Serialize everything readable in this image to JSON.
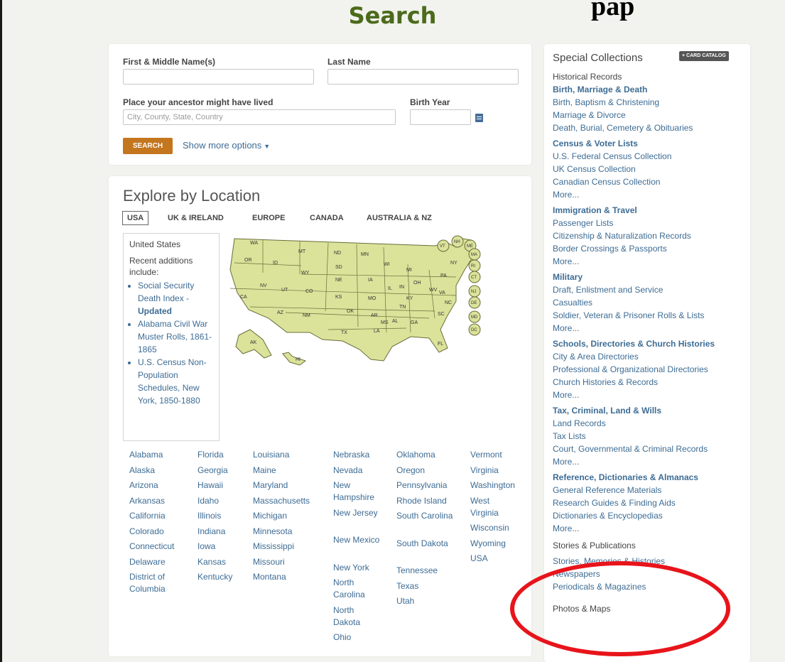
{
  "header": {
    "title": "Search",
    "corner_text": "pap"
  },
  "search_form": {
    "first_name_label": "First & Middle Name(s)",
    "last_name_label": "Last Name",
    "place_label": "Place your ancestor might have lived",
    "place_placeholder": "City, County, State, Country",
    "birth_year_label": "Birth Year",
    "search_button": "SEARCH",
    "more_options": "Show more options"
  },
  "explore": {
    "title": "Explore by Location",
    "tabs": [
      "USA",
      "UK & IRELAND",
      "EUROPE",
      "CANADA",
      "AUSTRALIA & NZ"
    ],
    "info_country": "United States",
    "recent_label": "Recent additions include:",
    "recent_items": [
      {
        "text": "Social Security Death Index -",
        "suffix": "Updated"
      },
      {
        "text": "Alabama Civil War Muster Rolls, 1861-1865",
        "suffix": ""
      },
      {
        "text": "U.S. Census Non-Population Schedules, New York, 1850-1880",
        "suffix": ""
      }
    ],
    "map_labels": [
      "WA",
      "MT",
      "ND",
      "MN",
      "OR",
      "ID",
      "SD",
      "WI",
      "WY",
      "MI",
      "NY",
      "NE",
      "IA",
      "NV",
      "UT",
      "CO",
      "IL",
      "IN",
      "OH",
      "PA",
      "CA",
      "KS",
      "MO",
      "KY",
      "WV",
      "VA",
      "AZ",
      "NM",
      "OK",
      "AR",
      "TN",
      "NC",
      "SC",
      "MS",
      "AL",
      "GA",
      "TX",
      "LA",
      "FL",
      "AK",
      "HI"
    ],
    "east_labels": [
      "VT",
      "NH",
      "ME",
      "MA",
      "RI",
      "CT",
      "NJ",
      "DE",
      "MD",
      "DC"
    ],
    "states": [
      "Alabama",
      "Alaska",
      "Arizona",
      "Arkansas",
      "California",
      "Colorado",
      "Connecticut",
      "Delaware",
      "District of Columbia",
      "Florida",
      "Georgia",
      "Hawaii",
      "Idaho",
      "Illinois",
      "Indiana",
      "Iowa",
      "Kansas",
      "Kentucky",
      "Louisiana",
      "Maine",
      "Maryland",
      "Massachusetts",
      "Michigan",
      "Minnesota",
      "Mississippi",
      "Missouri",
      "Montana",
      "Nebraska",
      "Nevada",
      "New Hampshire",
      "New Jersey",
      "New Mexico",
      "New York",
      "North Carolina",
      "North Dakota",
      "Ohio",
      "Oklahoma",
      "Oregon",
      "Pennsylvania",
      "Rhode Island",
      "South Carolina",
      "South Dakota",
      "Tennessee",
      "Texas",
      "Utah",
      "Vermont",
      "Virginia",
      "Washington",
      "West Virginia",
      "Wisconsin",
      "Wyoming",
      "USA"
    ]
  },
  "special": {
    "title": "Special Collections",
    "card_catalog": "+ CARD CATALOG",
    "lines": [
      {
        "t": "Historical Records",
        "k": "plain"
      },
      {
        "t": "Birth, Marriage & Death",
        "k": "head"
      },
      {
        "t": "Birth, Baptism & Christening",
        "k": "link"
      },
      {
        "t": "Marriage & Divorce",
        "k": "link"
      },
      {
        "t": "Death, Burial, Cemetery & Obituaries",
        "k": "link"
      },
      {
        "t": "Census & Voter Lists",
        "k": "head"
      },
      {
        "t": "U.S. Federal Census Collection",
        "k": "link"
      },
      {
        "t": "UK Census Collection",
        "k": "link"
      },
      {
        "t": "Canadian Census Collection",
        "k": "link"
      },
      {
        "t": "More...",
        "k": "link"
      },
      {
        "t": "Immigration & Travel",
        "k": "head"
      },
      {
        "t": "Passenger Lists",
        "k": "link"
      },
      {
        "t": "Citizenship & Naturalization Records",
        "k": "link"
      },
      {
        "t": "Border Crossings & Passports",
        "k": "link"
      },
      {
        "t": "More...",
        "k": "link"
      },
      {
        "t": "Military",
        "k": "head"
      },
      {
        "t": "Draft, Enlistment and Service",
        "k": "link"
      },
      {
        "t": "Casualties",
        "k": "link"
      },
      {
        "t": "Soldier, Veteran & Prisoner Rolls & Lists",
        "k": "link"
      },
      {
        "t": "More...",
        "k": "link"
      },
      {
        "t": "Schools, Directories & Church Histories",
        "k": "head"
      },
      {
        "t": "City & Area Directories",
        "k": "link"
      },
      {
        "t": "Professional & Organizational Directories",
        "k": "link"
      },
      {
        "t": "Church Histories & Records",
        "k": "link"
      },
      {
        "t": "More...",
        "k": "link"
      },
      {
        "t": "Tax, Criminal, Land & Wills",
        "k": "head"
      },
      {
        "t": "Land Records",
        "k": "link"
      },
      {
        "t": "Tax Lists",
        "k": "link"
      },
      {
        "t": "Court, Governmental & Criminal Records",
        "k": "link"
      },
      {
        "t": "More...",
        "k": "link"
      },
      {
        "t": "Reference, Dictionaries & Almanacs",
        "k": "head"
      },
      {
        "t": "General Reference Materials",
        "k": "link"
      },
      {
        "t": "Research Guides & Finding Aids",
        "k": "link"
      },
      {
        "t": "Dictionaries & Encyclopedias",
        "k": "link"
      },
      {
        "t": "More...",
        "k": "link"
      },
      {
        "t": "Stories & Publications",
        "k": "plain"
      },
      {
        "t": "Stories, Memories & Histories",
        "k": "link"
      },
      {
        "t": "Newspapers",
        "k": "link"
      },
      {
        "t": "Periodicals & Magazines",
        "k": "link"
      },
      {
        "t": "Photos & Maps",
        "k": "plain"
      }
    ]
  },
  "colors": {
    "accent_green": "#4b6a1b",
    "link_blue": "#3d6c94",
    "search_orange": "#c4761e",
    "highlight_red": "#e8141b"
  }
}
